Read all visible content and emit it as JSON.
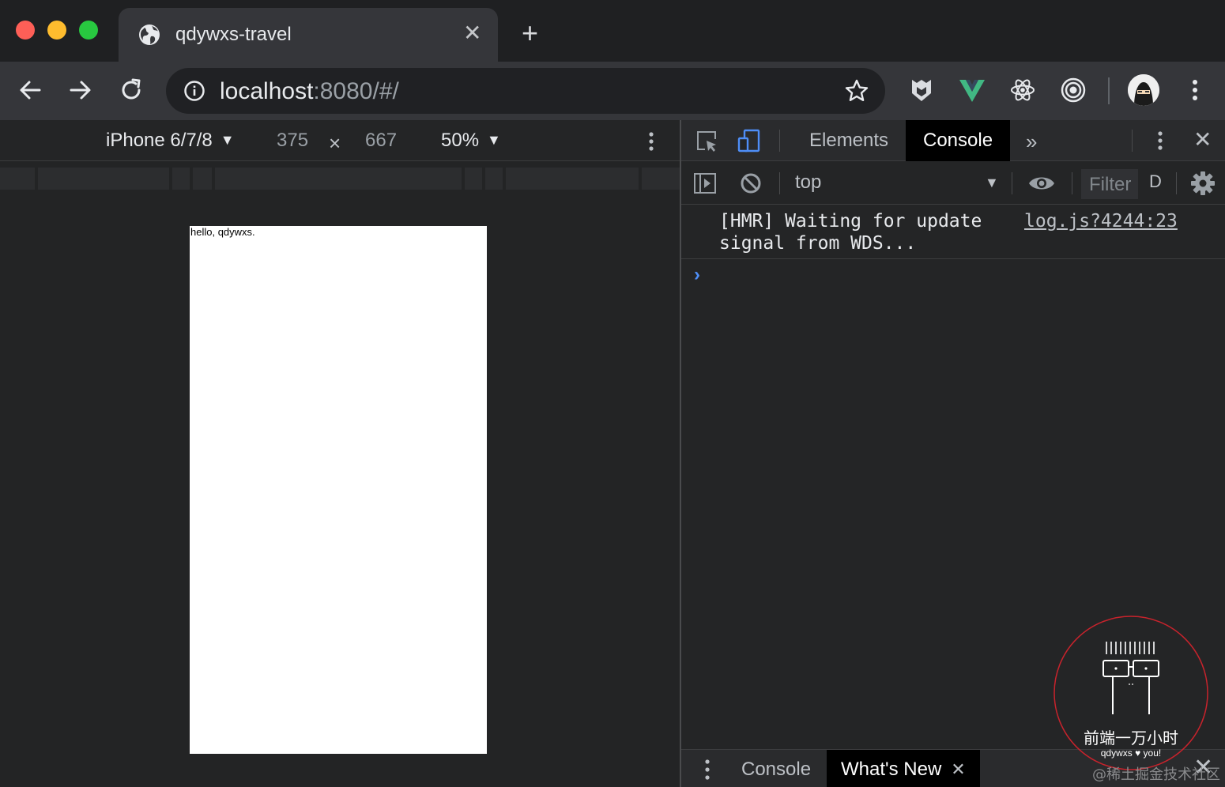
{
  "browser": {
    "tab_title": "qdywxs-travel",
    "tab_close": "✕",
    "new_tab": "+",
    "url_host": "localhost",
    "url_rest": ":8080/#/"
  },
  "device_toolbar": {
    "device": "iPhone 6/7/8",
    "width": "375",
    "times": "×",
    "height": "667",
    "zoom": "50%",
    "caret": "▼"
  },
  "page": {
    "text": "hello, qdywxs."
  },
  "devtools": {
    "tabs": [
      {
        "label": "Elements"
      },
      {
        "label": "Console"
      }
    ],
    "more_tabs": "»",
    "close": "✕",
    "context": "top",
    "context_caret": "▼",
    "filter_placeholder": "Filter",
    "levels": "D",
    "messages": [
      {
        "text": "[HMR] Waiting for update signal from WDS...",
        "source": "log.js?4244:23"
      }
    ],
    "prompt": "›"
  },
  "drawer": {
    "tabs": [
      {
        "label": "Console"
      },
      {
        "label": "What's New"
      }
    ],
    "tab_close": "✕",
    "close": "✕"
  },
  "watermark": {
    "title": "前端一万小时",
    "subtitle": "qdywxs ♥ you!",
    "site": "@稀土掘金技术社区"
  },
  "colors": {
    "background": "#232425",
    "toolbar": "#35363a",
    "link_blue": "#4e8ef7",
    "vue_green": "#41b883",
    "watermark_red": "#c8232c"
  }
}
